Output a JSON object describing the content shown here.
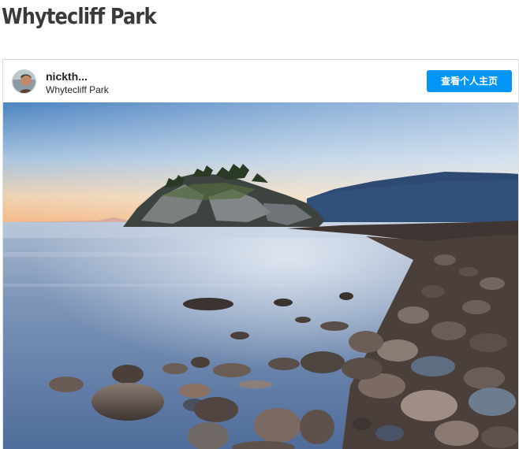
{
  "page": {
    "title": "Whytecliff Park"
  },
  "post": {
    "username": "nickth...",
    "location": "Whytecliff Park",
    "profile_button_label": "查看个人主页",
    "colors": {
      "button": "#0095f6",
      "title_text": "#3a3a3a"
    },
    "icons": {
      "avatar": "user-avatar-photo"
    }
  }
}
